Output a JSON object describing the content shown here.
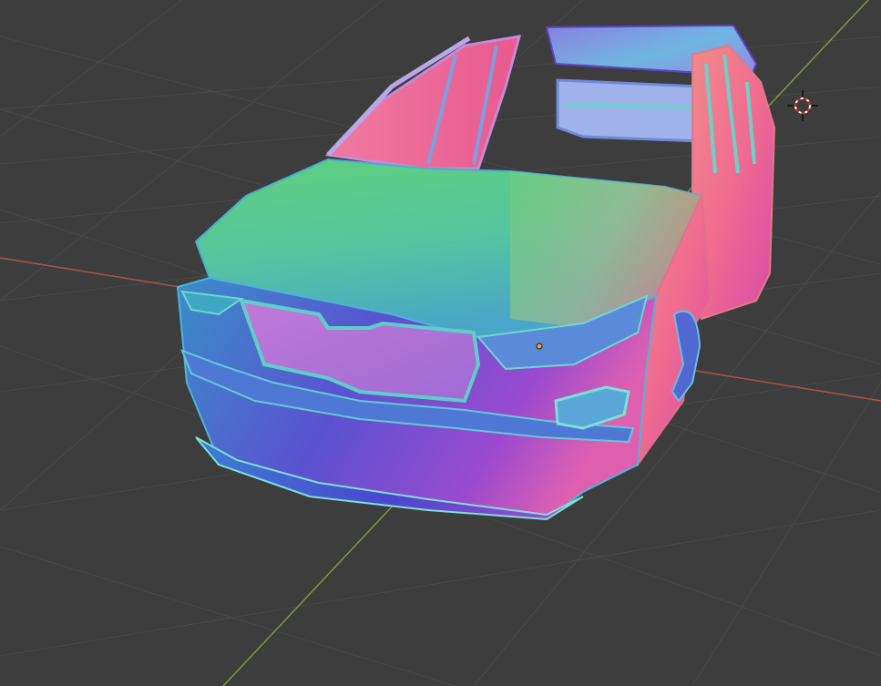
{
  "viewport": {
    "mode": "3d-viewport",
    "shading": "normal-map",
    "background_color": "#3d3d3d",
    "grid_color": "#4a4a4a",
    "x_axis_color": "#b0524f",
    "y_axis_color": "#7d9a3a"
  },
  "scene": {
    "object": "car-body-mesh",
    "parts": [
      "hood",
      "front-bumper",
      "grille",
      "left-headlight",
      "right-headlight",
      "fog-light",
      "front-door-open",
      "roof-frame",
      "rear-door",
      "wheel-arch"
    ]
  },
  "overlays": {
    "cursor_3d": "3d-cursor-icon",
    "origin": "object-origin-icon"
  }
}
